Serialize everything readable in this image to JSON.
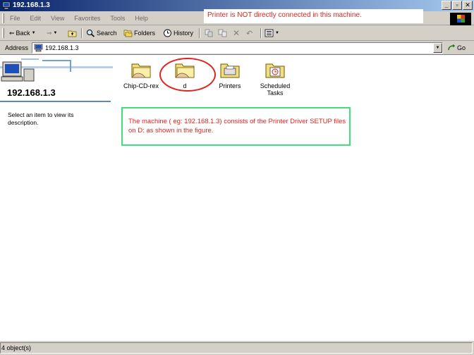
{
  "window": {
    "title": "192.168.1.3"
  },
  "menu": [
    "File",
    "Edit",
    "View",
    "Favorites",
    "Tools",
    "Help"
  ],
  "overlay_note": "Printer is NOT directly connected in this machine.",
  "toolbar": {
    "back_label": "Back",
    "search_label": "Search",
    "folders_label": "Folders",
    "history_label": "History"
  },
  "address": {
    "label": "Address",
    "value": "192.168.1.3",
    "go_label": "Go"
  },
  "panel": {
    "title": "192.168.1.3",
    "description": "Select an item to view its description."
  },
  "items": [
    {
      "label": "Chip-CD-rex",
      "icon": "shared-folder-icon"
    },
    {
      "label": "d",
      "icon": "shared-folder-icon"
    },
    {
      "label": "Printers",
      "icon": "printers-folder-icon"
    },
    {
      "label": "Scheduled Tasks",
      "icon": "scheduled-tasks-icon"
    }
  ],
  "annotation": "The machine ( eg: 192.168.1.3) consists of the Printer Driver SETUP files on D: as shown in the figure.",
  "status": {
    "text": "4 object(s)"
  },
  "colors": {
    "title_bar": "#0a246a",
    "annotation_text": "#e0241f",
    "annotation_border": "#3fe07a",
    "highlight_circle": "#e0241f"
  }
}
